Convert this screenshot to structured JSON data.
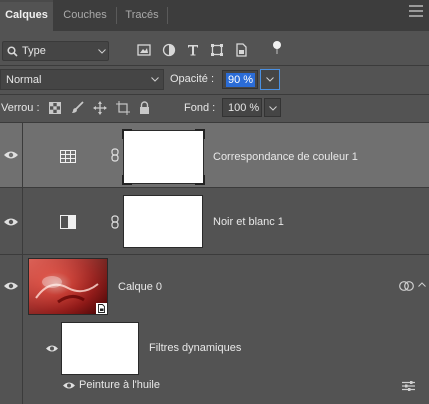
{
  "tabs": [
    {
      "label": "Calques",
      "active": true
    },
    {
      "label": "Couches",
      "active": false
    },
    {
      "label": "Tracés",
      "active": false
    }
  ],
  "filter": {
    "value": "Type"
  },
  "blend_mode": {
    "value": "Normal"
  },
  "opacity": {
    "label": "Opacité :",
    "value": "90 %"
  },
  "lock": {
    "label": "Verrou :"
  },
  "fill": {
    "label": "Fond :",
    "value": "100 %"
  },
  "layers": [
    {
      "name": "Correspondance de couleur 1",
      "type": "adjustment",
      "icon": "grid-table-icon",
      "selected": true
    },
    {
      "name": "Noir et blanc 1",
      "type": "adjustment",
      "icon": "black-white-icon",
      "selected": false
    },
    {
      "name": "Calque 0",
      "type": "smart-object",
      "selected": false
    }
  ],
  "smart_filters": {
    "label": "Filtres dynamiques",
    "items": [
      {
        "name": "Peinture à l'huile"
      }
    ]
  },
  "colors": {
    "panel": "#535353",
    "tabbar": "#3d3d3d",
    "selected_row": "#707070",
    "highlight": "#2b6cd6"
  }
}
